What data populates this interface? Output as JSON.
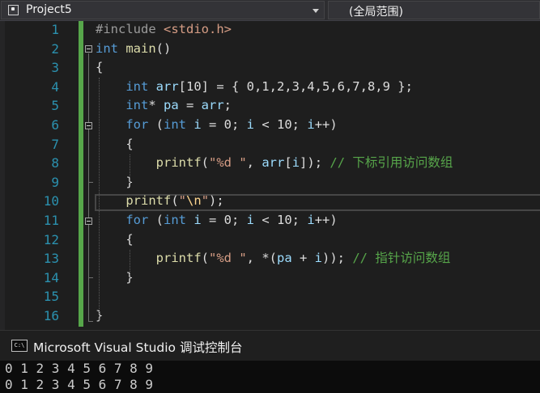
{
  "toolbar": {
    "project_label": "Project5",
    "scope_label": "(全局范围)",
    "project_icon": "project-icon",
    "dropdown_icon": "chevron-down-icon"
  },
  "editor": {
    "lines": [
      {
        "num": "1",
        "tokens": [
          {
            "t": "#include ",
            "c": "pp"
          },
          {
            "t": "<stdio.h>",
            "c": "inc"
          }
        ]
      },
      {
        "num": "2",
        "tokens": [
          {
            "t": "int",
            "c": "kw"
          },
          {
            "t": " main",
            "c": "fn"
          },
          {
            "t": "()",
            "c": "op"
          }
        ]
      },
      {
        "num": "3",
        "tokens": [
          {
            "t": "{",
            "c": "op"
          }
        ]
      },
      {
        "num": "4",
        "tokens": [
          {
            "t": "    int",
            "c": "kw"
          },
          {
            "t": " arr",
            "c": "id"
          },
          {
            "t": "[10] = { 0,1,2,3,4,5,6,7,8,9 };",
            "c": "op"
          }
        ]
      },
      {
        "num": "5",
        "tokens": [
          {
            "t": "    int",
            "c": "kw"
          },
          {
            "t": "* ",
            "c": "op"
          },
          {
            "t": "pa",
            "c": "id"
          },
          {
            "t": " = ",
            "c": "op"
          },
          {
            "t": "arr",
            "c": "id"
          },
          {
            "t": ";",
            "c": "op"
          }
        ]
      },
      {
        "num": "6",
        "tokens": [
          {
            "t": "    for",
            "c": "kw"
          },
          {
            "t": " (",
            "c": "op"
          },
          {
            "t": "int",
            "c": "kw"
          },
          {
            "t": " i",
            "c": "id"
          },
          {
            "t": " = 0; ",
            "c": "op"
          },
          {
            "t": "i",
            "c": "id"
          },
          {
            "t": " < 10; ",
            "c": "op"
          },
          {
            "t": "i",
            "c": "id"
          },
          {
            "t": "++)",
            "c": "op"
          }
        ]
      },
      {
        "num": "7",
        "tokens": [
          {
            "t": "    {",
            "c": "op"
          }
        ]
      },
      {
        "num": "8",
        "tokens": [
          {
            "t": "        printf",
            "c": "fn"
          },
          {
            "t": "(",
            "c": "op"
          },
          {
            "t": "\"%d \"",
            "c": "str"
          },
          {
            "t": ", ",
            "c": "op"
          },
          {
            "t": "arr",
            "c": "id"
          },
          {
            "t": "[",
            "c": "op"
          },
          {
            "t": "i",
            "c": "id"
          },
          {
            "t": "]); ",
            "c": "op"
          },
          {
            "t": "// 下标引用访问数组",
            "c": "cm"
          }
        ]
      },
      {
        "num": "9",
        "tokens": [
          {
            "t": "    }",
            "c": "op"
          }
        ]
      },
      {
        "num": "10",
        "tokens": [
          {
            "t": "    printf",
            "c": "fn"
          },
          {
            "t": "(",
            "c": "op"
          },
          {
            "t": "\"",
            "c": "str"
          },
          {
            "t": "\\n",
            "c": "esc"
          },
          {
            "t": "\"",
            "c": "str"
          },
          {
            "t": ");",
            "c": "op"
          }
        ]
      },
      {
        "num": "11",
        "tokens": [
          {
            "t": "    for",
            "c": "kw"
          },
          {
            "t": " (",
            "c": "op"
          },
          {
            "t": "int",
            "c": "kw"
          },
          {
            "t": " i",
            "c": "id"
          },
          {
            "t": " = 0; ",
            "c": "op"
          },
          {
            "t": "i",
            "c": "id"
          },
          {
            "t": " < 10; ",
            "c": "op"
          },
          {
            "t": "i",
            "c": "id"
          },
          {
            "t": "++)",
            "c": "op"
          }
        ]
      },
      {
        "num": "12",
        "tokens": [
          {
            "t": "    {",
            "c": "op"
          }
        ]
      },
      {
        "num": "13",
        "tokens": [
          {
            "t": "        printf",
            "c": "fn"
          },
          {
            "t": "(",
            "c": "op"
          },
          {
            "t": "\"%d \"",
            "c": "str"
          },
          {
            "t": ", *(",
            "c": "op"
          },
          {
            "t": "pa",
            "c": "id"
          },
          {
            "t": " + ",
            "c": "op"
          },
          {
            "t": "i",
            "c": "id"
          },
          {
            "t": ")); ",
            "c": "op"
          },
          {
            "t": "// 指针访问数组",
            "c": "cm"
          }
        ]
      },
      {
        "num": "14",
        "tokens": [
          {
            "t": "    }",
            "c": "op"
          }
        ]
      },
      {
        "num": "15",
        "tokens": []
      },
      {
        "num": "16",
        "tokens": [
          {
            "t": "}",
            "c": "op"
          }
        ]
      }
    ]
  },
  "console": {
    "title": "Microsoft Visual Studio 调试控制台",
    "icon": "console-icon",
    "icon_text": "C:\\",
    "output": [
      "0 1 2 3 4 5 6 7 8 9",
      "0 1 2 3 4 5 6 7 8 9"
    ]
  },
  "colors": {
    "keyword": "#569cd6",
    "string": "#d69d85",
    "comment": "#57a64a",
    "identifier": "#9cdcfe",
    "function": "#dcdcaa",
    "line_number": "#2b91af",
    "change_bar": "#57a64a"
  }
}
